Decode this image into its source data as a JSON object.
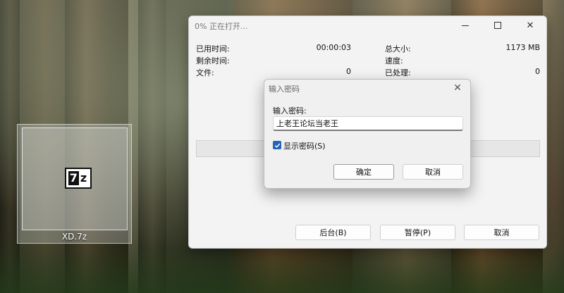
{
  "desktop": {
    "file_icon": {
      "name": "XD.7z",
      "icon": "7z-archive-icon",
      "glyph_a": "7",
      "glyph_b": "z"
    }
  },
  "progress_window": {
    "title": "0% 正在打开...",
    "stats_left": [
      {
        "label": "已用时间:",
        "value": "00:00:03"
      },
      {
        "label": "剩余时间:",
        "value": ""
      },
      {
        "label": "文件:",
        "value": "0"
      }
    ],
    "stats_right": [
      {
        "label": "总大小:",
        "value": "1173 MB"
      },
      {
        "label": "速度:",
        "value": ""
      },
      {
        "label": "已处理:",
        "value": "0"
      }
    ],
    "progress": 0,
    "buttons": {
      "background": "后台(B)",
      "pause": "暂停(P)",
      "cancel": "取消"
    }
  },
  "password_dialog": {
    "title": "输入密码",
    "prompt": "输入密码:",
    "password_value": "上老王论坛当老王",
    "show_password": {
      "label": "显示密码(S)",
      "checked": true
    },
    "ok_label": "确定",
    "cancel_label": "取消"
  },
  "colors": {
    "accent": "#2563b8",
    "window_bg": "#f3f3f3"
  }
}
